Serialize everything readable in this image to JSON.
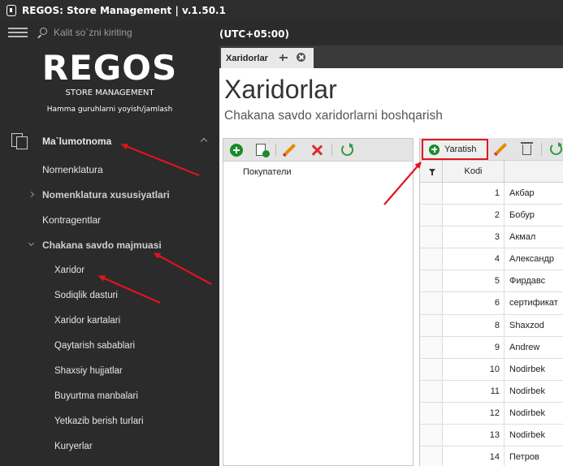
{
  "window": {
    "title": "REGOS: Store Management | v.1.50.1"
  },
  "search": {
    "placeholder": "Kalit so`zni kiriting"
  },
  "logo": {
    "word": "REGOS",
    "subtitle": "STORE MANAGEMENT",
    "tagline": "Hamma guruhlarni yoyish/jamlash"
  },
  "sidebar": {
    "section": "Ma`lumotnoma",
    "items": [
      {
        "label": "Nomenklatura"
      },
      {
        "label": "Nomenklatura xususiyatlari"
      },
      {
        "label": "Kontragentlar"
      },
      {
        "label": "Chakana savdo majmuasi"
      },
      {
        "label": "Xaridor"
      },
      {
        "label": "Sodiqlik dasturi"
      },
      {
        "label": "Xaridor kartalari"
      },
      {
        "label": "Qaytarish sabablari"
      },
      {
        "label": "Shaxsiy hujjatlar"
      },
      {
        "label": "Buyurtma manbalari"
      },
      {
        "label": "Yetkazib berish turlari"
      },
      {
        "label": "Kuryerlar"
      }
    ]
  },
  "header": {
    "timezone": "(UTC+05:00)"
  },
  "tab": {
    "label": "Xaridorlar"
  },
  "main": {
    "title": "Xaridorlar",
    "subtitle": "Chakana savdo xaridorlarni boshqarish",
    "tree_node": "Покупатели",
    "create_label": "Yaratish",
    "kodi_header": "Kodi"
  },
  "table": {
    "rows": [
      {
        "kodi": "1",
        "name": "Акбар"
      },
      {
        "kodi": "2",
        "name": "Бобур"
      },
      {
        "kodi": "3",
        "name": "Акмал"
      },
      {
        "kodi": "4",
        "name": "Александр"
      },
      {
        "kodi": "5",
        "name": "Фирдавс"
      },
      {
        "kodi": "6",
        "name": "сертификат"
      },
      {
        "kodi": "8",
        "name": "Shaxzod"
      },
      {
        "kodi": "9",
        "name": "Andrew"
      },
      {
        "kodi": "10",
        "name": "Nodirbek"
      },
      {
        "kodi": "11",
        "name": "Nodirbek"
      },
      {
        "kodi": "12",
        "name": "Nodirbek"
      },
      {
        "kodi": "13",
        "name": "Nodirbek"
      },
      {
        "kodi": "14",
        "name": "Петров"
      }
    ]
  },
  "colors": {
    "accent_red": "#e0141e",
    "add_green": "#1a8c2a",
    "sidebar_bg": "#2b2b2b"
  }
}
